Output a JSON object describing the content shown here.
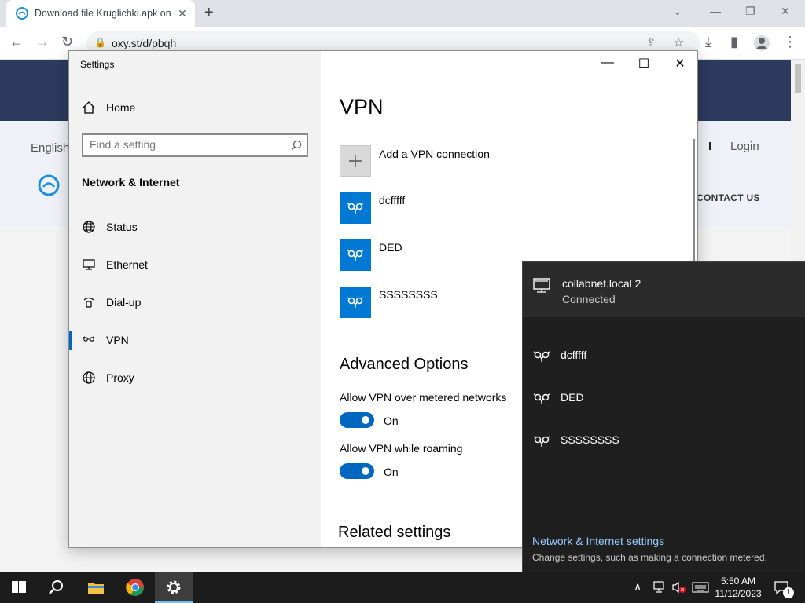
{
  "browser": {
    "tab_title": "Download file Kruglichki.apk on",
    "url": "oxy.st/d/pbqh"
  },
  "website": {
    "language": "English",
    "divider": "I",
    "login": "Login",
    "contact": "CONTACT US"
  },
  "settings": {
    "window_title": "Settings",
    "home_label": "Home",
    "search_placeholder": "Find a setting",
    "section_title": "Network & Internet",
    "nav_items": [
      {
        "label": "Status",
        "icon": "globe-icon"
      },
      {
        "label": "Ethernet",
        "icon": "ethernet-icon"
      },
      {
        "label": "Dial-up",
        "icon": "dialup-icon"
      },
      {
        "label": "VPN",
        "icon": "vpn-icon",
        "active": true
      },
      {
        "label": "Proxy",
        "icon": "globe-icon"
      }
    ],
    "page_title": "VPN",
    "add_vpn_label": "Add a VPN connection",
    "vpn_connections": [
      "dcfffff",
      "DED",
      "SSSSSSSS"
    ],
    "advanced_heading": "Advanced Options",
    "options": [
      {
        "label": "Allow VPN over metered networks",
        "state": "On",
        "enabled": true
      },
      {
        "label": "Allow VPN while roaming",
        "state": "On",
        "enabled": true
      }
    ],
    "related_heading": "Related settings"
  },
  "network_flyout": {
    "network_name": "collabnet.local 2",
    "network_status": "Connected",
    "vpn_list": [
      "dcfffff",
      "DED",
      "SSSSSSSS"
    ],
    "settings_link": "Network & Internet settings",
    "settings_desc": "Change settings, such as making a connection metered."
  },
  "taskbar": {
    "time": "5:50 AM",
    "date": "11/12/2023",
    "notification_count": "1"
  },
  "colors": {
    "accent": "#0078d4",
    "flyout_bg": "#1f1f1f",
    "site_header": "#2c3a5d"
  }
}
